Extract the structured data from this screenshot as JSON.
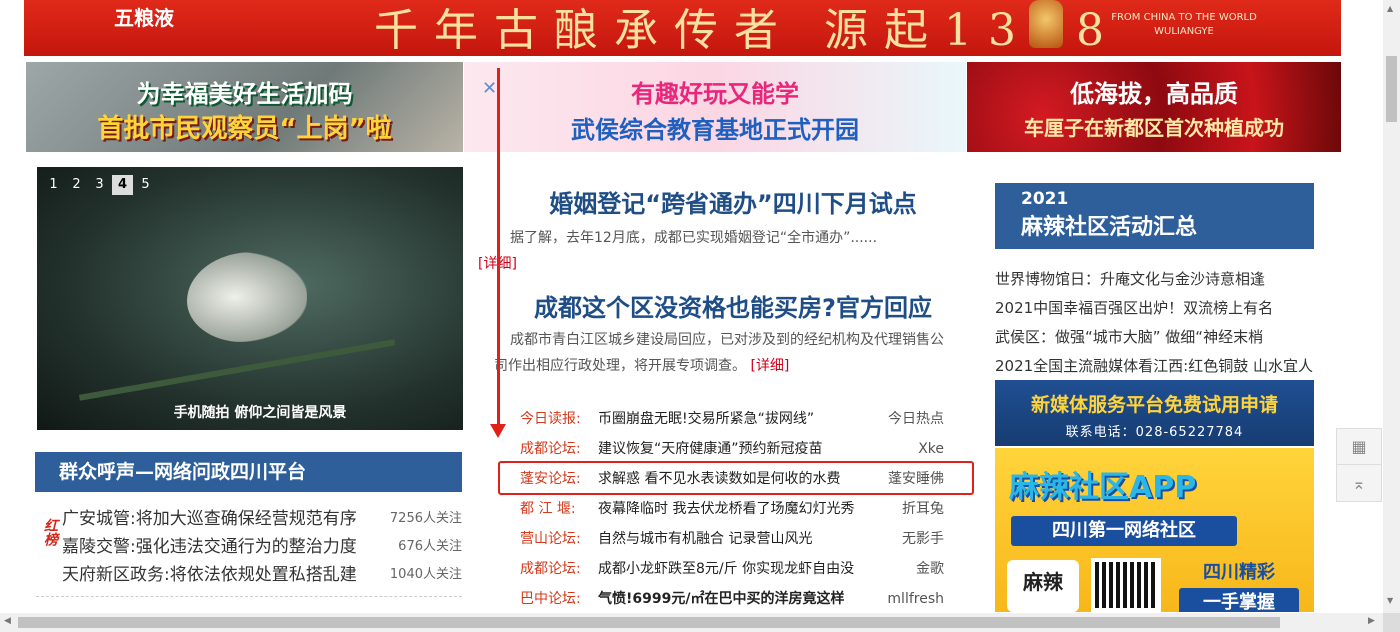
{
  "top_banner": {
    "brand_left": "五粮液",
    "slogan": "千年古酿承传者 源起1368",
    "brand_right_en": "FROM CHINA TO THE WORLD",
    "brand_right_name": "WULIANGYE"
  },
  "ads": [
    {
      "line1": "为幸福美好生活加码",
      "line2": "首批市民观察员“上岗”啦"
    },
    {
      "line1": "有趣好玩又能学",
      "line2": "武侯综合教育基地正式开园"
    },
    {
      "line1": "低海拔，高品质",
      "line2": "车厘子在新都区首次种植成功"
    }
  ],
  "slideshow": {
    "pages": [
      "1",
      "2",
      "3",
      "4",
      "5"
    ],
    "active_page": "4",
    "caption": "手机随拍 俯仰之间皆是风景"
  },
  "appeal_section": {
    "title": "群众呼声—网络问政四川平台",
    "hot_label": "红榜",
    "items": [
      {
        "title": "广安城管:将加大巡查确保经营规范有序",
        "count": "7256人关注"
      },
      {
        "title": "嘉陵交警:强化违法交通行为的整治力度",
        "count": "676人关注"
      },
      {
        "title": "天府新区政务:将依法依规处置私搭乱建",
        "count": "1040人关注"
      }
    ]
  },
  "news": [
    {
      "title": "婚姻登记“跨省通办”四川下月试点",
      "desc": "据了解，去年12月底，成都已实现婚姻登记“全市通办”......",
      "more": "[详细]"
    },
    {
      "title": "成都这个区没资格也能买房?官方回应",
      "desc": "成都市青白江区城乡建设局回应，已对涉及到的经纪机构及代理销售公司作出相应行政处理，将开展专项调查。",
      "more": "[详细]"
    }
  ],
  "forum_posts": [
    {
      "source": "今日读报:",
      "title": "币圈崩盘无眠!交易所紧急“拔网线”",
      "author": "今日热点"
    },
    {
      "source": "成都论坛:",
      "title": "建议恢复“天府健康通”预约新冠疫苗",
      "author": "Xke"
    },
    {
      "source": "蓬安论坛:",
      "title": "求解惑 看不见水表读数如是何收的水费",
      "author": "蓬安睡佛"
    },
    {
      "source": "都 江 堰:",
      "title": "夜幕降临时 我去伏龙桥看了场魔幻灯光秀",
      "author": "折耳兔"
    },
    {
      "source": "营山论坛:",
      "title": "自然与城市有机融合 记录营山风光",
      "author": "无影手"
    },
    {
      "source": "成都论坛:",
      "title": "成都小龙虾跌至8元/斤 你实现龙虾自由没",
      "author": "金歌"
    },
    {
      "source": "巴中论坛:",
      "title": "气愤!6999元/㎡在巴中买的洋房竟这样",
      "author": "mllfresh"
    }
  ],
  "summary_box": {
    "year": "2021",
    "title": "麻辣社区活动汇总"
  },
  "right_links": [
    "世界博物馆日：升庵文化与金沙诗意相逢",
    "2021中国幸福百强区出炉！双流榜上有名",
    "武侯区：做强“城市大脑” 做细“神经末梢",
    "2021全国主流融媒体看江西:红色铜鼓 山水宜人"
  ],
  "media_ad": {
    "title": "新媒体服务平台免费试用申请",
    "phone": "联系电话：028-65227784"
  },
  "app_ad": {
    "title": "麻辣社区APP",
    "subtitle": "四川第一网络社区",
    "logo": "麻辣",
    "side1": "四川精彩",
    "side2": "一手掌握"
  },
  "colors": {
    "accent_blue": "#2e5f9a",
    "title_blue": "#1f4d86",
    "source_red": "#d43a1b",
    "highlight_red": "#e0201a"
  },
  "icons": {
    "float_tool_1": "qr-code-icon",
    "float_tool_2": "back-to-top-icon"
  }
}
